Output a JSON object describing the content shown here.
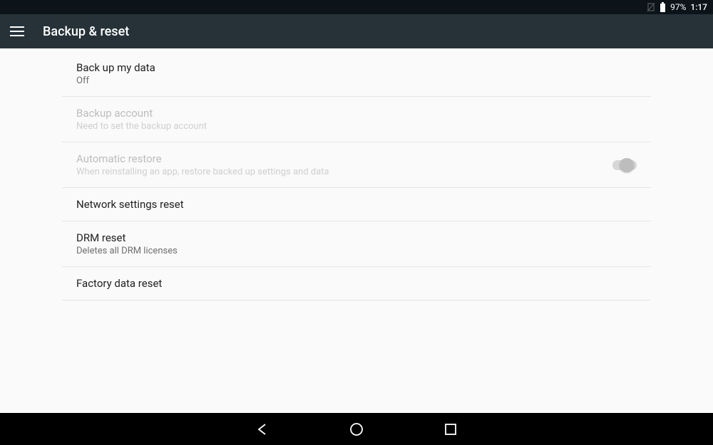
{
  "status": {
    "battery_pct": "97%",
    "time": "1:17"
  },
  "header": {
    "title": "Backup & reset"
  },
  "items": {
    "backup_data": {
      "title": "Back up my data",
      "sub": "Off"
    },
    "backup_account": {
      "title": "Backup account",
      "sub": "Need to set the backup account"
    },
    "auto_restore": {
      "title": "Automatic restore",
      "sub": "When reinstalling an app, restore backed up settings and data",
      "switch_on": false
    },
    "network_reset": {
      "title": "Network settings reset"
    },
    "drm_reset": {
      "title": "DRM reset",
      "sub": "Deletes all DRM licenses"
    },
    "factory_reset": {
      "title": "Factory data reset"
    }
  }
}
